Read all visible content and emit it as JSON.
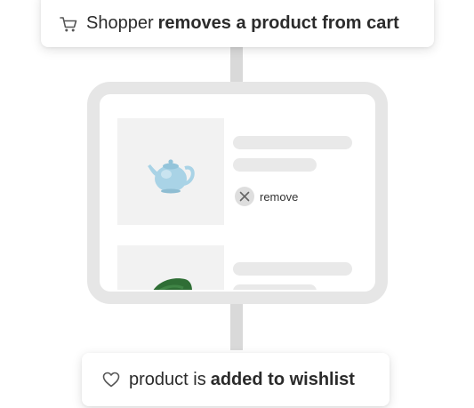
{
  "top_event": {
    "icon": "cart-icon",
    "prefix": "Shopper",
    "action": "removes a product from cart"
  },
  "cart": {
    "items": [
      {
        "image": "teapot-image",
        "action_icon": "close-icon",
        "action_label": "remove"
      },
      {
        "image": "green-chair-image"
      }
    ]
  },
  "bottom_event": {
    "icon": "heart-icon",
    "prefix": "product is",
    "action": "added to wishlist"
  },
  "colors": {
    "text": "#2b2b2b",
    "card_background": "#ffffff",
    "device_frame": "#e6e6e6",
    "skeleton": "#e9e9e9",
    "image_placeholder": "#f2f2f2",
    "teapot": "#a9d3e6",
    "chair": "#2f6e35",
    "connector": "#d9d9d9"
  }
}
